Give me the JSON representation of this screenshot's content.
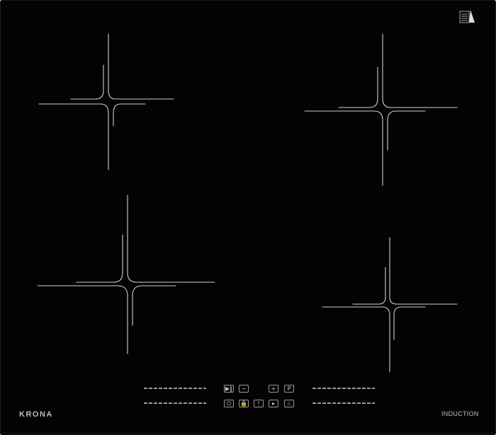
{
  "brand": {
    "name": "KRONA"
  },
  "badge": {
    "text": "INDUCTION"
  },
  "controls": {
    "top_row": [
      {
        "name": "pause-button",
        "glyph": "▶‖"
      },
      {
        "name": "minus-button",
        "glyph": "−"
      },
      {
        "name": "plus-button",
        "glyph": "+"
      },
      {
        "name": "booster-button",
        "glyph": "P"
      }
    ],
    "bottom_row": [
      {
        "name": "power-button",
        "glyph": "⏻"
      },
      {
        "name": "lock-button",
        "glyph": "🔒"
      },
      {
        "name": "timer-button",
        "glyph": "!"
      },
      {
        "name": "boost-arrow-button",
        "glyph": "▸"
      },
      {
        "name": "keep-warm-button",
        "glyph": "♨"
      }
    ]
  },
  "colors": {
    "glass": "#030303",
    "zone_lines": "#cfcfcf",
    "print": "#bcbcbc"
  },
  "icons": [
    "cooking-zone-marker-icon",
    "certification-logo-icon"
  ]
}
